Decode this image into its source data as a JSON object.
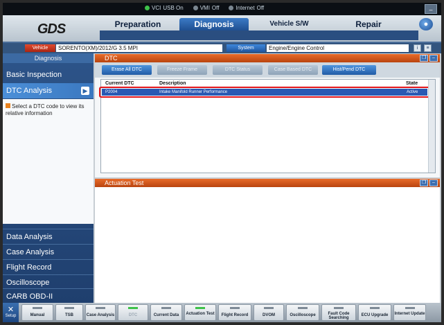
{
  "status_bar": {
    "items": [
      "VCI",
      "USB On",
      "VMI",
      "Off",
      "Internet",
      "Off"
    ],
    "window_button": "–"
  },
  "logo": "GDS",
  "main_nav": {
    "tabs": [
      {
        "label": "Preparation"
      },
      {
        "label": "Diagnosis"
      },
      {
        "label": "Vehicle S/W Management"
      },
      {
        "label": "Repair"
      }
    ]
  },
  "vehicle_bar": {
    "vehicle_button": "Vehicle",
    "vehicle_value": "SORENTO(XM)/2012/G 3.5 MPI",
    "system_button": "System",
    "system_value": "Engine/Engine Control"
  },
  "sidebar": {
    "header": "Diagnosis",
    "items": [
      {
        "label": "Basic Inspection"
      },
      {
        "label": "DTC Analysis"
      }
    ],
    "help_text": "Select a DTC code to view its relative information",
    "bottom_items": [
      {
        "label": "Data Analysis"
      },
      {
        "label": "Case Analysis"
      },
      {
        "label": "Flight Record"
      },
      {
        "label": "Oscilloscope"
      },
      {
        "label": "CARB OBD-II"
      }
    ]
  },
  "dtc_panel": {
    "title": "DTC",
    "toolbar": [
      {
        "label": "Erase All DTC",
        "enabled": true
      },
      {
        "label": "Freeze Frame",
        "enabled": false
      },
      {
        "label": "DTC Status",
        "enabled": false
      },
      {
        "label": "Case Based DTC",
        "enabled": false
      },
      {
        "label": "Hist/Pend DTC",
        "enabled": true
      }
    ],
    "columns": [
      "Current DTC",
      "Description",
      "State"
    ],
    "rows": [
      {
        "code": "P2004",
        "description": "Intake Manifold Runner Performance",
        "state": "Active"
      }
    ]
  },
  "actuation_panel": {
    "title": "Actuation Test"
  },
  "bottom_toolbar": {
    "setup_label": "Setup",
    "buttons": [
      {
        "label": "Manual",
        "indicator": "off"
      },
      {
        "label": "TSB",
        "indicator": "off"
      },
      {
        "label": "Case Analysis",
        "indicator": "off"
      },
      {
        "label": "DTC",
        "indicator": "green"
      },
      {
        "label": "Current Data",
        "indicator": "off"
      },
      {
        "label": "Actuation Test",
        "indicator": "green"
      },
      {
        "label": "Flight Record",
        "indicator": "off"
      },
      {
        "label": "DVOM",
        "indicator": "off"
      },
      {
        "label": "Oscilloscope",
        "indicator": "off"
      },
      {
        "label": "Fault Code Searching",
        "indicator": "off"
      },
      {
        "label": "ECU Upgrade",
        "indicator": "off"
      },
      {
        "label": "Internet Update",
        "indicator": "off"
      }
    ]
  },
  "colors": {
    "accent": "#2a59b3",
    "panel_header": "#e96c2a",
    "highlight": "#e0141a",
    "sidebar": "#2d5489"
  }
}
